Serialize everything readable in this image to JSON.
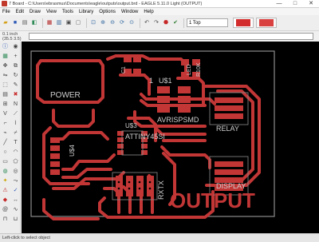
{
  "window": {
    "title": "7 Board - C:\\Users\\ebrasmus\\Documents\\eagle\\outputs\\output.brd - EAGLE 5.11.0 Light (OUTPUT)",
    "minimize": "—",
    "maximize": "□",
    "close": "✕"
  },
  "menu": [
    "File",
    "Edit",
    "Draw",
    "View",
    "Tools",
    "Library",
    "Options",
    "Window",
    "Help"
  ],
  "toolbar": {
    "layer_combo": "1 Top",
    "icons": [
      "open-icon",
      "save-icon",
      "print-icon",
      "cam-icon",
      "board-icon",
      "schematic-icon",
      "script-icon",
      "run-icon",
      "zoom-fit-icon",
      "zoom-in-icon",
      "zoom-out-icon",
      "zoom-redraw-icon",
      "zoom-area-icon",
      "undo-icon",
      "redo-icon",
      "stop-icon",
      "go-icon"
    ]
  },
  "commandline": {
    "coordinate": "0.1 inch (35.5 3.5)"
  },
  "board": {
    "labels": {
      "power": "POWER",
      "us1": "U$1",
      "avrispsmd": "AVRISPSMD",
      "relay": "RELAY",
      "us3": "U$3",
      "attiny": "ATTINY45SI",
      "us4": "U$4",
      "display": "DISPLAY",
      "rxtx": "RXTX",
      "output": "OUTPUT",
      "c1": "C1",
      "led": "LED",
      "r10k": "R10K",
      "pin1": "1"
    },
    "colors": {
      "background": "#000000",
      "copper": "#c23636",
      "pad": "#c23636",
      "outline": "#8c8c8c",
      "label": "#cfcfcf"
    }
  },
  "status": {
    "text": "Left-click to select object"
  }
}
